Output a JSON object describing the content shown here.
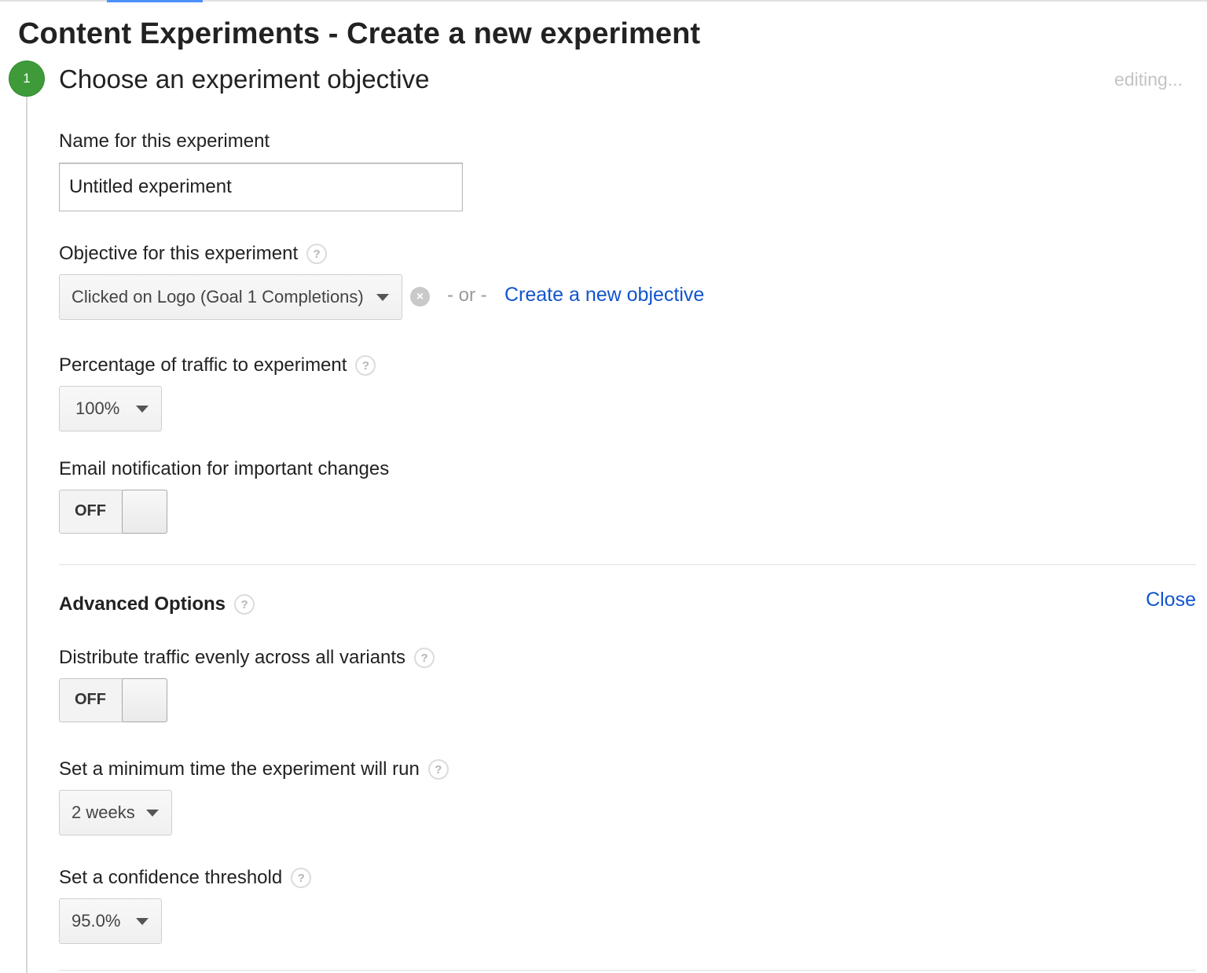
{
  "page": {
    "title": "Content Experiments - Create a new experiment"
  },
  "step": {
    "number": "1",
    "heading": "Choose an experiment objective",
    "status": "editing..."
  },
  "experiment_name": {
    "label": "Name for this experiment",
    "value": "Untitled experiment"
  },
  "objective": {
    "label": "Objective for this experiment",
    "selected": "Clicked on Logo (Goal 1 Completions)",
    "separator": "- or -",
    "create_link": "Create a new objective"
  },
  "traffic": {
    "label": "Percentage of traffic to experiment",
    "selected": "100%"
  },
  "email_notification": {
    "label": "Email notification for important changes",
    "toggle_text": "OFF"
  },
  "advanced_options": {
    "label": "Advanced Options",
    "close_link": "Close",
    "distribute": {
      "label": "Distribute traffic evenly across all variants",
      "toggle_text": "OFF"
    },
    "minimum_time": {
      "label": "Set a minimum time the experiment will run",
      "selected": "2 weeks"
    },
    "confidence": {
      "label": "Set a confidence threshold",
      "selected": "95.0%"
    }
  },
  "help_icon_glyph": "?",
  "clear_icon_glyph": "×",
  "icons": [
    "help-icon",
    "clear-icon",
    "chevron-down-icon"
  ],
  "colors": {
    "step_badge": "#3f9b3a",
    "link": "#1155cc",
    "tab_accent": "#4d90fe",
    "muted_text": "#999999"
  }
}
